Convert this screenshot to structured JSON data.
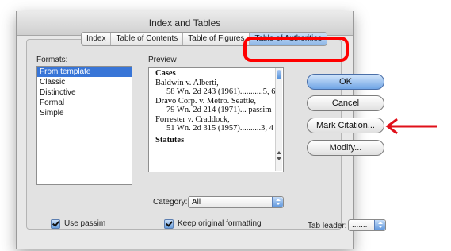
{
  "dialog": {
    "title": "Index and Tables"
  },
  "tabs": [
    {
      "label": "Index",
      "active": false
    },
    {
      "label": "Table of Contents",
      "active": false
    },
    {
      "label": "Table of Figures",
      "active": false
    },
    {
      "label": "Table of Authorities",
      "active": true
    }
  ],
  "formats": {
    "label": "Formats:",
    "items": [
      "From template",
      "Classic",
      "Distinctive",
      "Formal",
      "Simple"
    ],
    "selected": "From template"
  },
  "preview": {
    "label": "Preview",
    "lines": [
      {
        "text": "Cases",
        "style": "heading"
      },
      {
        "text": "Baldwin v. Alberti,",
        "style": "normal"
      },
      {
        "text": "58 Wn. 2d 243 (1961)...........5, 6",
        "style": "indent"
      },
      {
        "text": "Dravo Corp. v. Metro. Seattle,",
        "style": "normal"
      },
      {
        "text": "79 Wn. 2d 214 (1971)... passim",
        "style": "indent"
      },
      {
        "text": "Forrester v. Craddock,",
        "style": "normal"
      },
      {
        "text": "51 Wn. 2d 315 (1957)..........3, 4",
        "style": "indent"
      },
      {
        "text": "Statutes",
        "style": "heading-cut"
      }
    ]
  },
  "buttons": {
    "ok": "OK",
    "cancel": "Cancel",
    "mark_citation": "Mark Citation...",
    "modify": "Modify..."
  },
  "category": {
    "label": "Category:",
    "value": "All"
  },
  "options": {
    "use_passim": {
      "label": "Use passim",
      "checked": true
    },
    "keep_formatting": {
      "label": "Keep original formatting",
      "checked": true
    }
  },
  "tab_leader": {
    "label": "Tab leader:",
    "value": "......."
  },
  "annotation": {
    "highlight_color": "#ff0000",
    "arrow_color": "#e0101a"
  },
  "colors": {
    "accent": "#3875d7"
  }
}
